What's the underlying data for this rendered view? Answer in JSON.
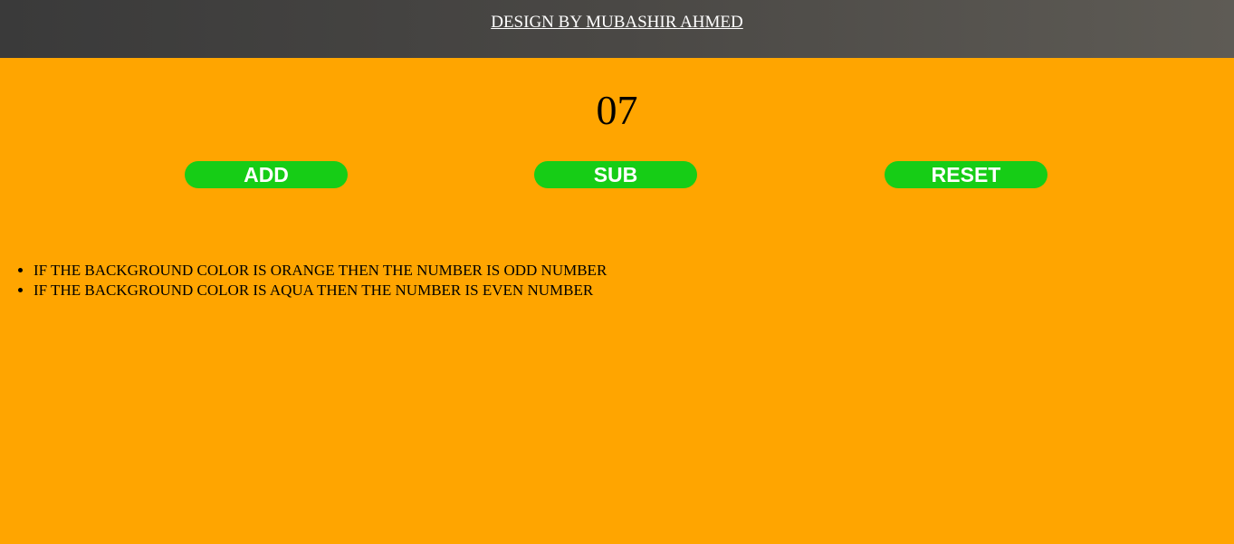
{
  "header": {
    "title_link": "DESIGN BY MUBASHIR AHMED"
  },
  "counter": {
    "value": "07"
  },
  "buttons": {
    "add_label": "ADD",
    "sub_label": "SUB",
    "reset_label": "RESET"
  },
  "info": {
    "items": [
      "IF THE BACKGROUND COLOR IS ORANGE THEN THE NUMBER IS ODD NUMBER",
      "IF THE BACKGROUND COLOR IS AQUA THEN THE NUMBER IS EVEN NUMBER"
    ]
  },
  "colors": {
    "page_background": "#FFA500",
    "button_background": "#16CD16",
    "button_text": "#FFFFFF",
    "header_background_start": "#3A3A3A",
    "header_background_end": "#5E5B55",
    "header_text": "#FFFFFF"
  }
}
